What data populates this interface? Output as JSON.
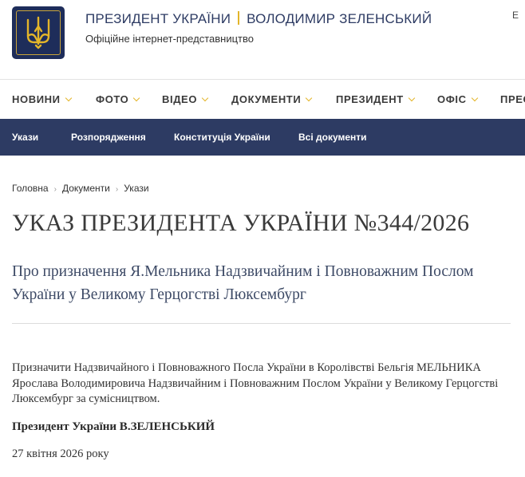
{
  "header": {
    "title_left": "ПРЕЗИДЕНТ УКРАЇНИ",
    "title_right": "ВОЛОДИМИР ЗЕЛЕНСЬКИЙ",
    "subtitle": "Офіційне інтернет-представництво",
    "lang_partial": "Е",
    "logo_icon": "trident-icon"
  },
  "main_nav": {
    "items": [
      {
        "label": "НОВИНИ"
      },
      {
        "label": "ФОТО"
      },
      {
        "label": "ВІДЕО"
      },
      {
        "label": "ДОКУМЕНТИ"
      },
      {
        "label": "ПРЕЗИДЕНТ"
      },
      {
        "label": "ОФІС"
      },
      {
        "label": "ПРЕС"
      }
    ]
  },
  "sub_nav": {
    "items": [
      {
        "label": "Укази"
      },
      {
        "label": "Розпорядження"
      },
      {
        "label": "Конституція України"
      },
      {
        "label": "Всі документи"
      }
    ]
  },
  "breadcrumbs": [
    "Головна",
    "Документи",
    "Укази"
  ],
  "document": {
    "title": "УКАЗ ПРЕЗИДЕНТА УКРАЇНИ №344/2026",
    "subtitle": "Про призначення Я.Мельника Надзвичайним і Повноважним Послом України у Великому Герцогстві Люксембург",
    "body": "Призначити Надзвичайного і Повноважного Посла України в Королівстві Бельгія МЕЛЬНИКА Ярослава Володимировича Надзвичайним і Повноважним Послом України у Великому Герцогстві Люксембург за сумісництвом.",
    "signature": "Президент України В.ЗЕЛЕНСЬКИЙ",
    "date": "27 квітня 2026 року"
  },
  "colors": {
    "brand_navy": "#2d3b63",
    "accent_gold": "#e3b52a"
  }
}
